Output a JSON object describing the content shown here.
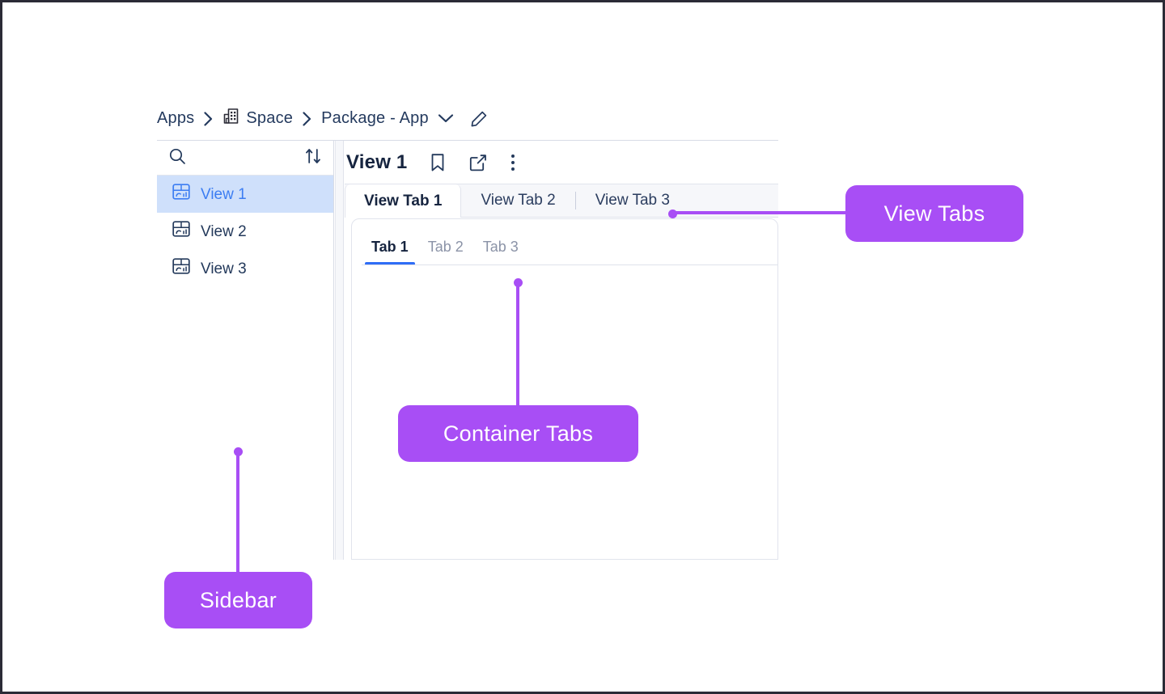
{
  "breadcrumb": {
    "items": [
      {
        "label": "Apps",
        "icon": null
      },
      {
        "label": "Space",
        "icon": "building-icon"
      },
      {
        "label": "Package - App",
        "icon": null
      }
    ],
    "separator": "›",
    "dropdown_icon": "chevron-down-icon",
    "edit_icon": "pencil-icon"
  },
  "sidebar": {
    "search_icon": "search-icon",
    "sort_icon": "sort-arrows-icon",
    "items": [
      {
        "label": "View 1",
        "icon": "dashboard-icon",
        "selected": true
      },
      {
        "label": "View 2",
        "icon": "dashboard-icon",
        "selected": false
      },
      {
        "label": "View 3",
        "icon": "dashboard-icon",
        "selected": false
      }
    ]
  },
  "content": {
    "title": "View 1",
    "actions": [
      {
        "name": "bookmark-icon",
        "label": "Bookmark"
      },
      {
        "name": "share-icon",
        "label": "Share"
      },
      {
        "name": "more-options-icon",
        "label": "More options"
      }
    ],
    "view_tabs": [
      {
        "label": "View Tab 1",
        "active": true
      },
      {
        "label": "View Tab 2",
        "active": false
      },
      {
        "label": "View Tab 3",
        "active": false
      }
    ],
    "container_tabs": [
      {
        "label": "Tab 1",
        "active": true
      },
      {
        "label": "Tab 2",
        "active": false
      },
      {
        "label": "Tab 3",
        "active": false
      }
    ]
  },
  "annotations": [
    {
      "label": "View Tabs"
    },
    {
      "label": "Container Tabs"
    },
    {
      "label": "Sidebar"
    }
  ],
  "colors": {
    "annotation": "#a84ef5",
    "selected_item_bg": "#cfe0fb",
    "selected_item_text": "#3c7df2",
    "active_tab_underline": "#2f6df6",
    "text_primary": "#16243f",
    "text_muted": "#8b93a7"
  }
}
